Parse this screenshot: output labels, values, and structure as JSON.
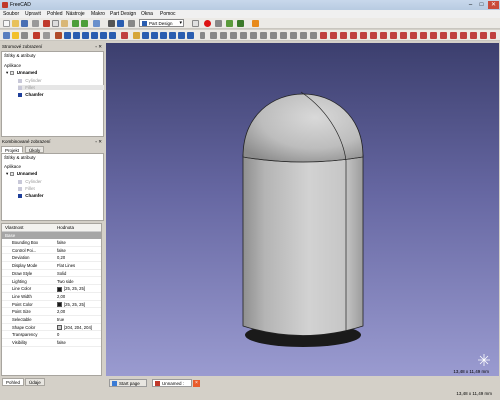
{
  "window": {
    "title": "FreeCAD",
    "minimize": "–",
    "maximize": "□",
    "close": "✕"
  },
  "menu": [
    "Soubor",
    "Upravit",
    "Pohled",
    "Nástroje",
    "Makro",
    "Part Design",
    "Okna",
    "Pomoc"
  ],
  "workbench": "Part Design",
  "combo_top": {
    "title": "Stromové zobrazení",
    "header": "Štítky & atributy",
    "section": "Aplikace",
    "document": "Unnamed",
    "items": [
      {
        "label": "Cylinder",
        "state": "hidden"
      },
      {
        "label": "Fillet",
        "state": "hidden"
      },
      {
        "label": "Chamfer",
        "state": "visible"
      }
    ]
  },
  "combo_bottom": {
    "title": "Kombinované zobrazení",
    "tabs": [
      "Projekt",
      "Úkoly"
    ],
    "header": "Štítky & atributy",
    "section": "Aplikace",
    "document": "Unnamed",
    "items": [
      {
        "label": "Cylinder",
        "state": "hidden"
      },
      {
        "label": "Fillet",
        "state": "hidden"
      },
      {
        "label": "Chamfer",
        "state": "visible"
      }
    ]
  },
  "properties": {
    "col_property": "Vlastnost",
    "col_value": "Hodnota",
    "group": "Base",
    "rows": [
      {
        "key": "Bounding Box",
        "value": "false"
      },
      {
        "key": "Control Poi...",
        "value": "false"
      },
      {
        "key": "Deviation",
        "value": "0,20"
      },
      {
        "key": "Display Mode",
        "value": "Flat Lines"
      },
      {
        "key": "Draw Style",
        "value": "Solid"
      },
      {
        "key": "Lighting",
        "value": "Two side"
      },
      {
        "key": "Line Color",
        "value": "[25, 25, 25]",
        "color": "#191919"
      },
      {
        "key": "Line Width",
        "value": "2,00"
      },
      {
        "key": "Point Color",
        "value": "[25, 25, 25]",
        "color": "#191919"
      },
      {
        "key": "Point Size",
        "value": "2,00"
      },
      {
        "key": "Selectable",
        "value": "true"
      },
      {
        "key": "Shape Color",
        "value": "[204, 204, 204]",
        "color": "#cccccc"
      },
      {
        "key": "Transparency",
        "value": "0"
      },
      {
        "key": "Visibility",
        "value": "false"
      }
    ]
  },
  "bottom_tabs": [
    "Pohled",
    "Údaje"
  ],
  "doc_tabs": [
    {
      "label": "Start page",
      "active": false
    },
    {
      "label": "Unnamed : 1*",
      "active": true
    }
  ],
  "viewport_dims": "13,48 x 11,49 mm",
  "colors": {
    "viewport_top": "#3c3f6e",
    "viewport_bottom": "#9a9bd0",
    "shape": "#cccccc",
    "line": "#191919"
  }
}
